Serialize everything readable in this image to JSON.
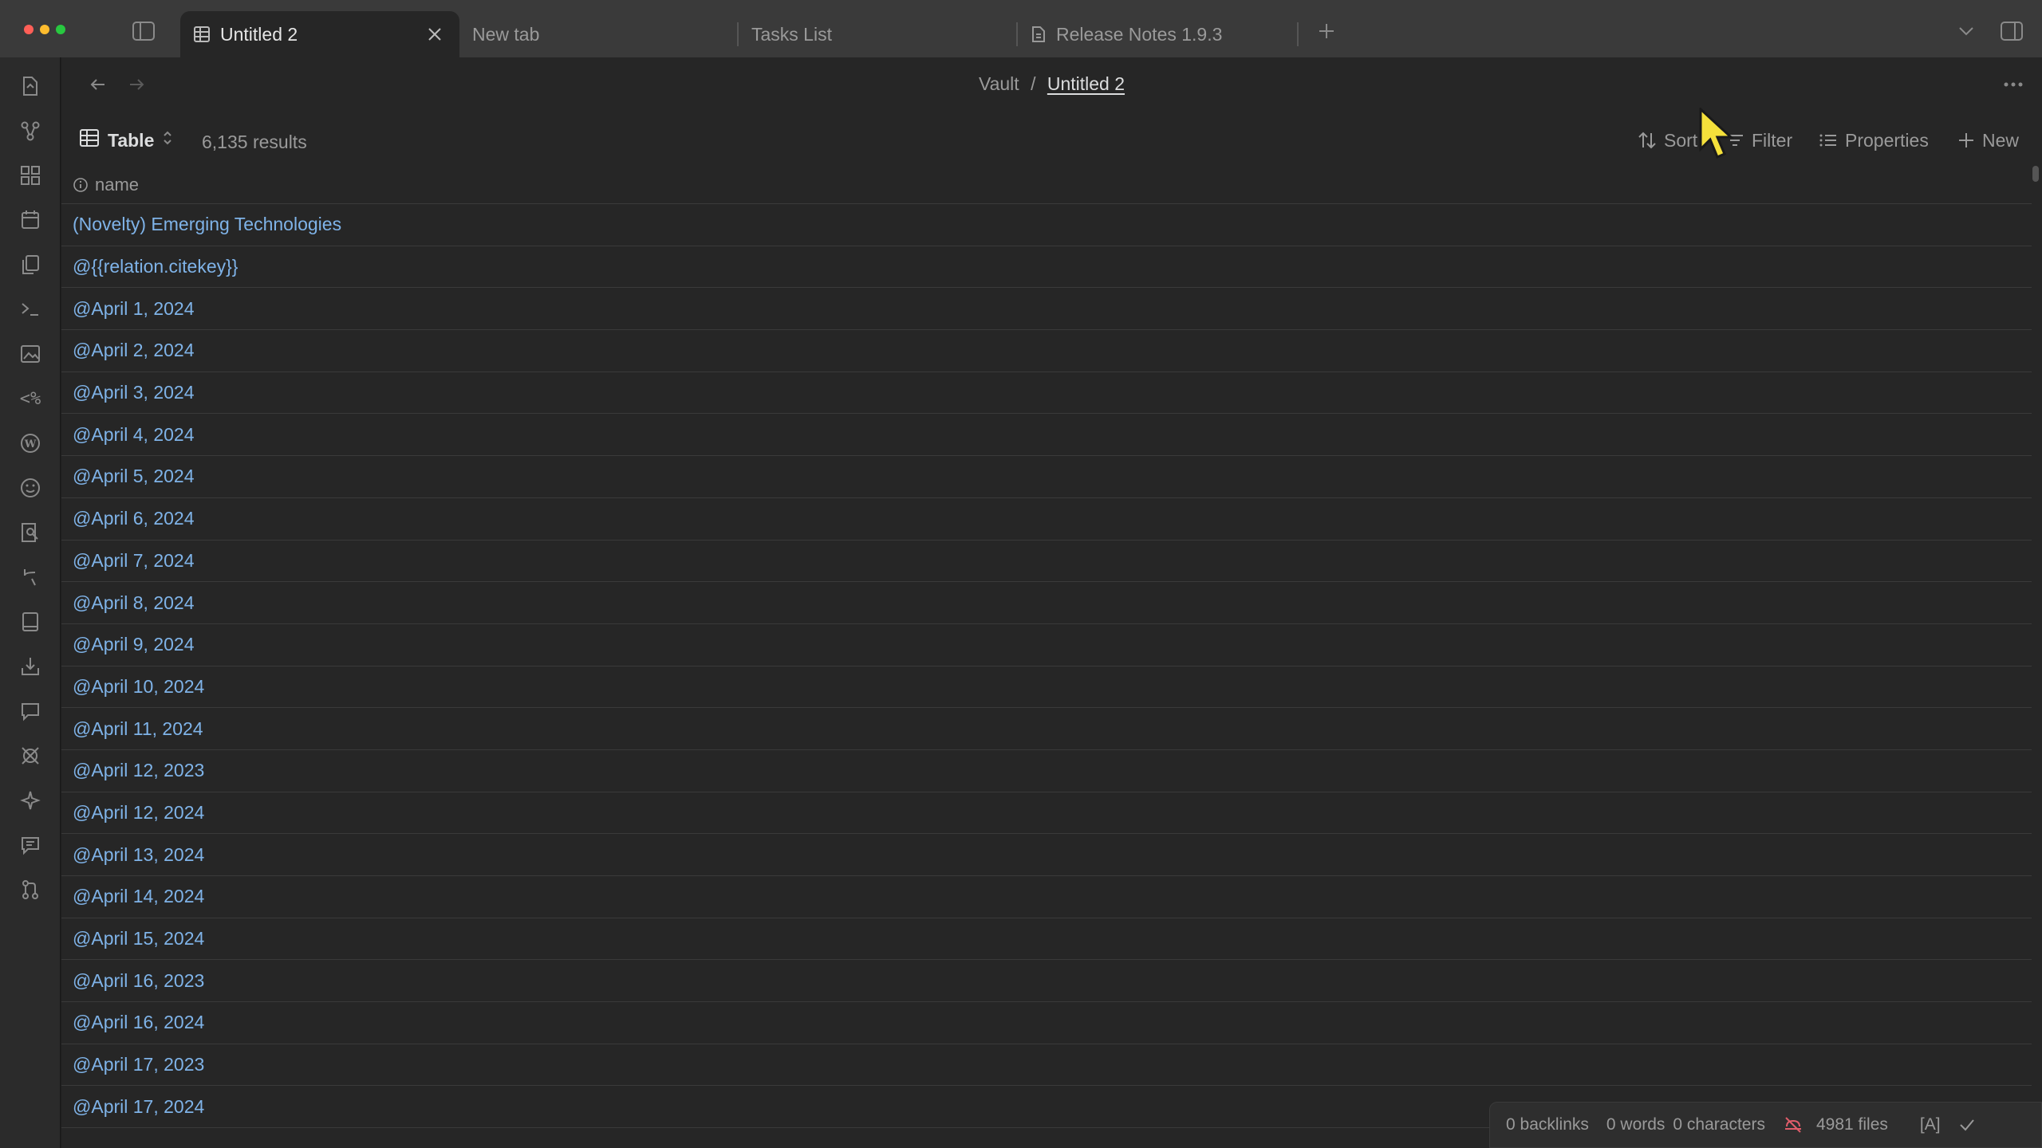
{
  "tabs": [
    {
      "label": "Untitled 2",
      "icon": "table-icon",
      "active": true
    },
    {
      "label": "New tab"
    },
    {
      "label": "Tasks List"
    },
    {
      "label": "Release Notes 1.9.3",
      "icon": "document-icon"
    }
  ],
  "breadcrumb": {
    "root": "Vault",
    "separator": "/",
    "current": "Untitled 2"
  },
  "toolbar": {
    "view_label": "Table",
    "result_count": "6,135 results",
    "sort_label": "Sort",
    "filter_label": "Filter",
    "properties_label": "Properties",
    "new_label": "New"
  },
  "table": {
    "column_header": "name",
    "rows": [
      "(Novelty) Emerging Technologies",
      "@{{relation.citekey}}",
      "@April 1, 2024",
      "@April 2, 2024",
      "@April 3, 2024",
      "@April 4, 2024",
      "@April 5, 2024",
      "@April 6, 2024",
      "@April 7, 2024",
      "@April 8, 2024",
      "@April 9, 2024",
      "@April 10, 2024",
      "@April 11, 2024",
      "@April 12, 2023",
      "@April 12, 2024",
      "@April 13, 2024",
      "@April 14, 2024",
      "@April 15, 2024",
      "@April 16, 2023",
      "@April 16, 2024",
      "@April 17, 2023",
      "@April 17, 2024"
    ]
  },
  "status": {
    "backlinks": "0 backlinks",
    "words": "0 words",
    "characters": "0 characters",
    "files": "4981 files",
    "mode": "[A]"
  },
  "colors": {
    "link": "#7fb3e8",
    "accent_cursor": "#f5e13b"
  }
}
